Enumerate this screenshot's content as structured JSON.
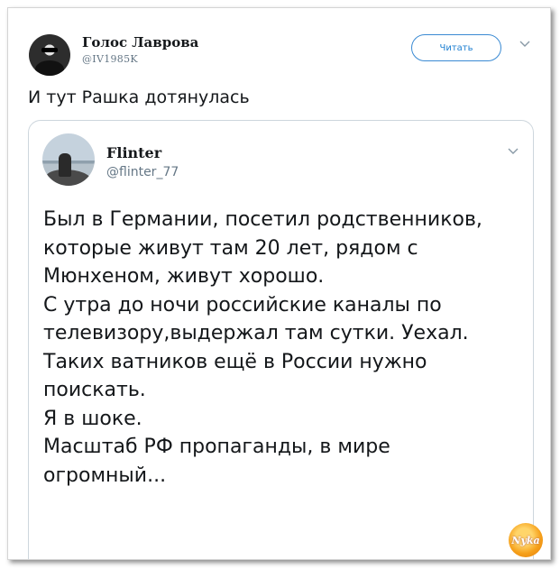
{
  "tweet": {
    "author_name": "Голос Лаврова",
    "author_handle": "@IV1985K",
    "follow_label": "Читать",
    "text": "И тут Рашка дотянулась"
  },
  "quoted": {
    "author_name": "Flinter",
    "author_handle": "@flinter_77",
    "lines": [
      "Был в Германии, посетил родственников,",
      "которые живут там 20 лет, рядом с",
      "Мюнхеном, живут хорошо.",
      "С утра до ночи российские каналы по",
      "телевизору,выдержал там сутки. Уехал.",
      "Таких ватников ещё в России нужно",
      "поискать.",
      "Я в шоке.",
      "Масштаб РФ пропаганды,  в мире",
      "огромный..."
    ]
  },
  "watermark": {
    "text": "Nyka"
  },
  "colors": {
    "accent": "#1d7fd1",
    "muted": "#657786",
    "text": "#14171a",
    "border": "#cdd6dd"
  }
}
